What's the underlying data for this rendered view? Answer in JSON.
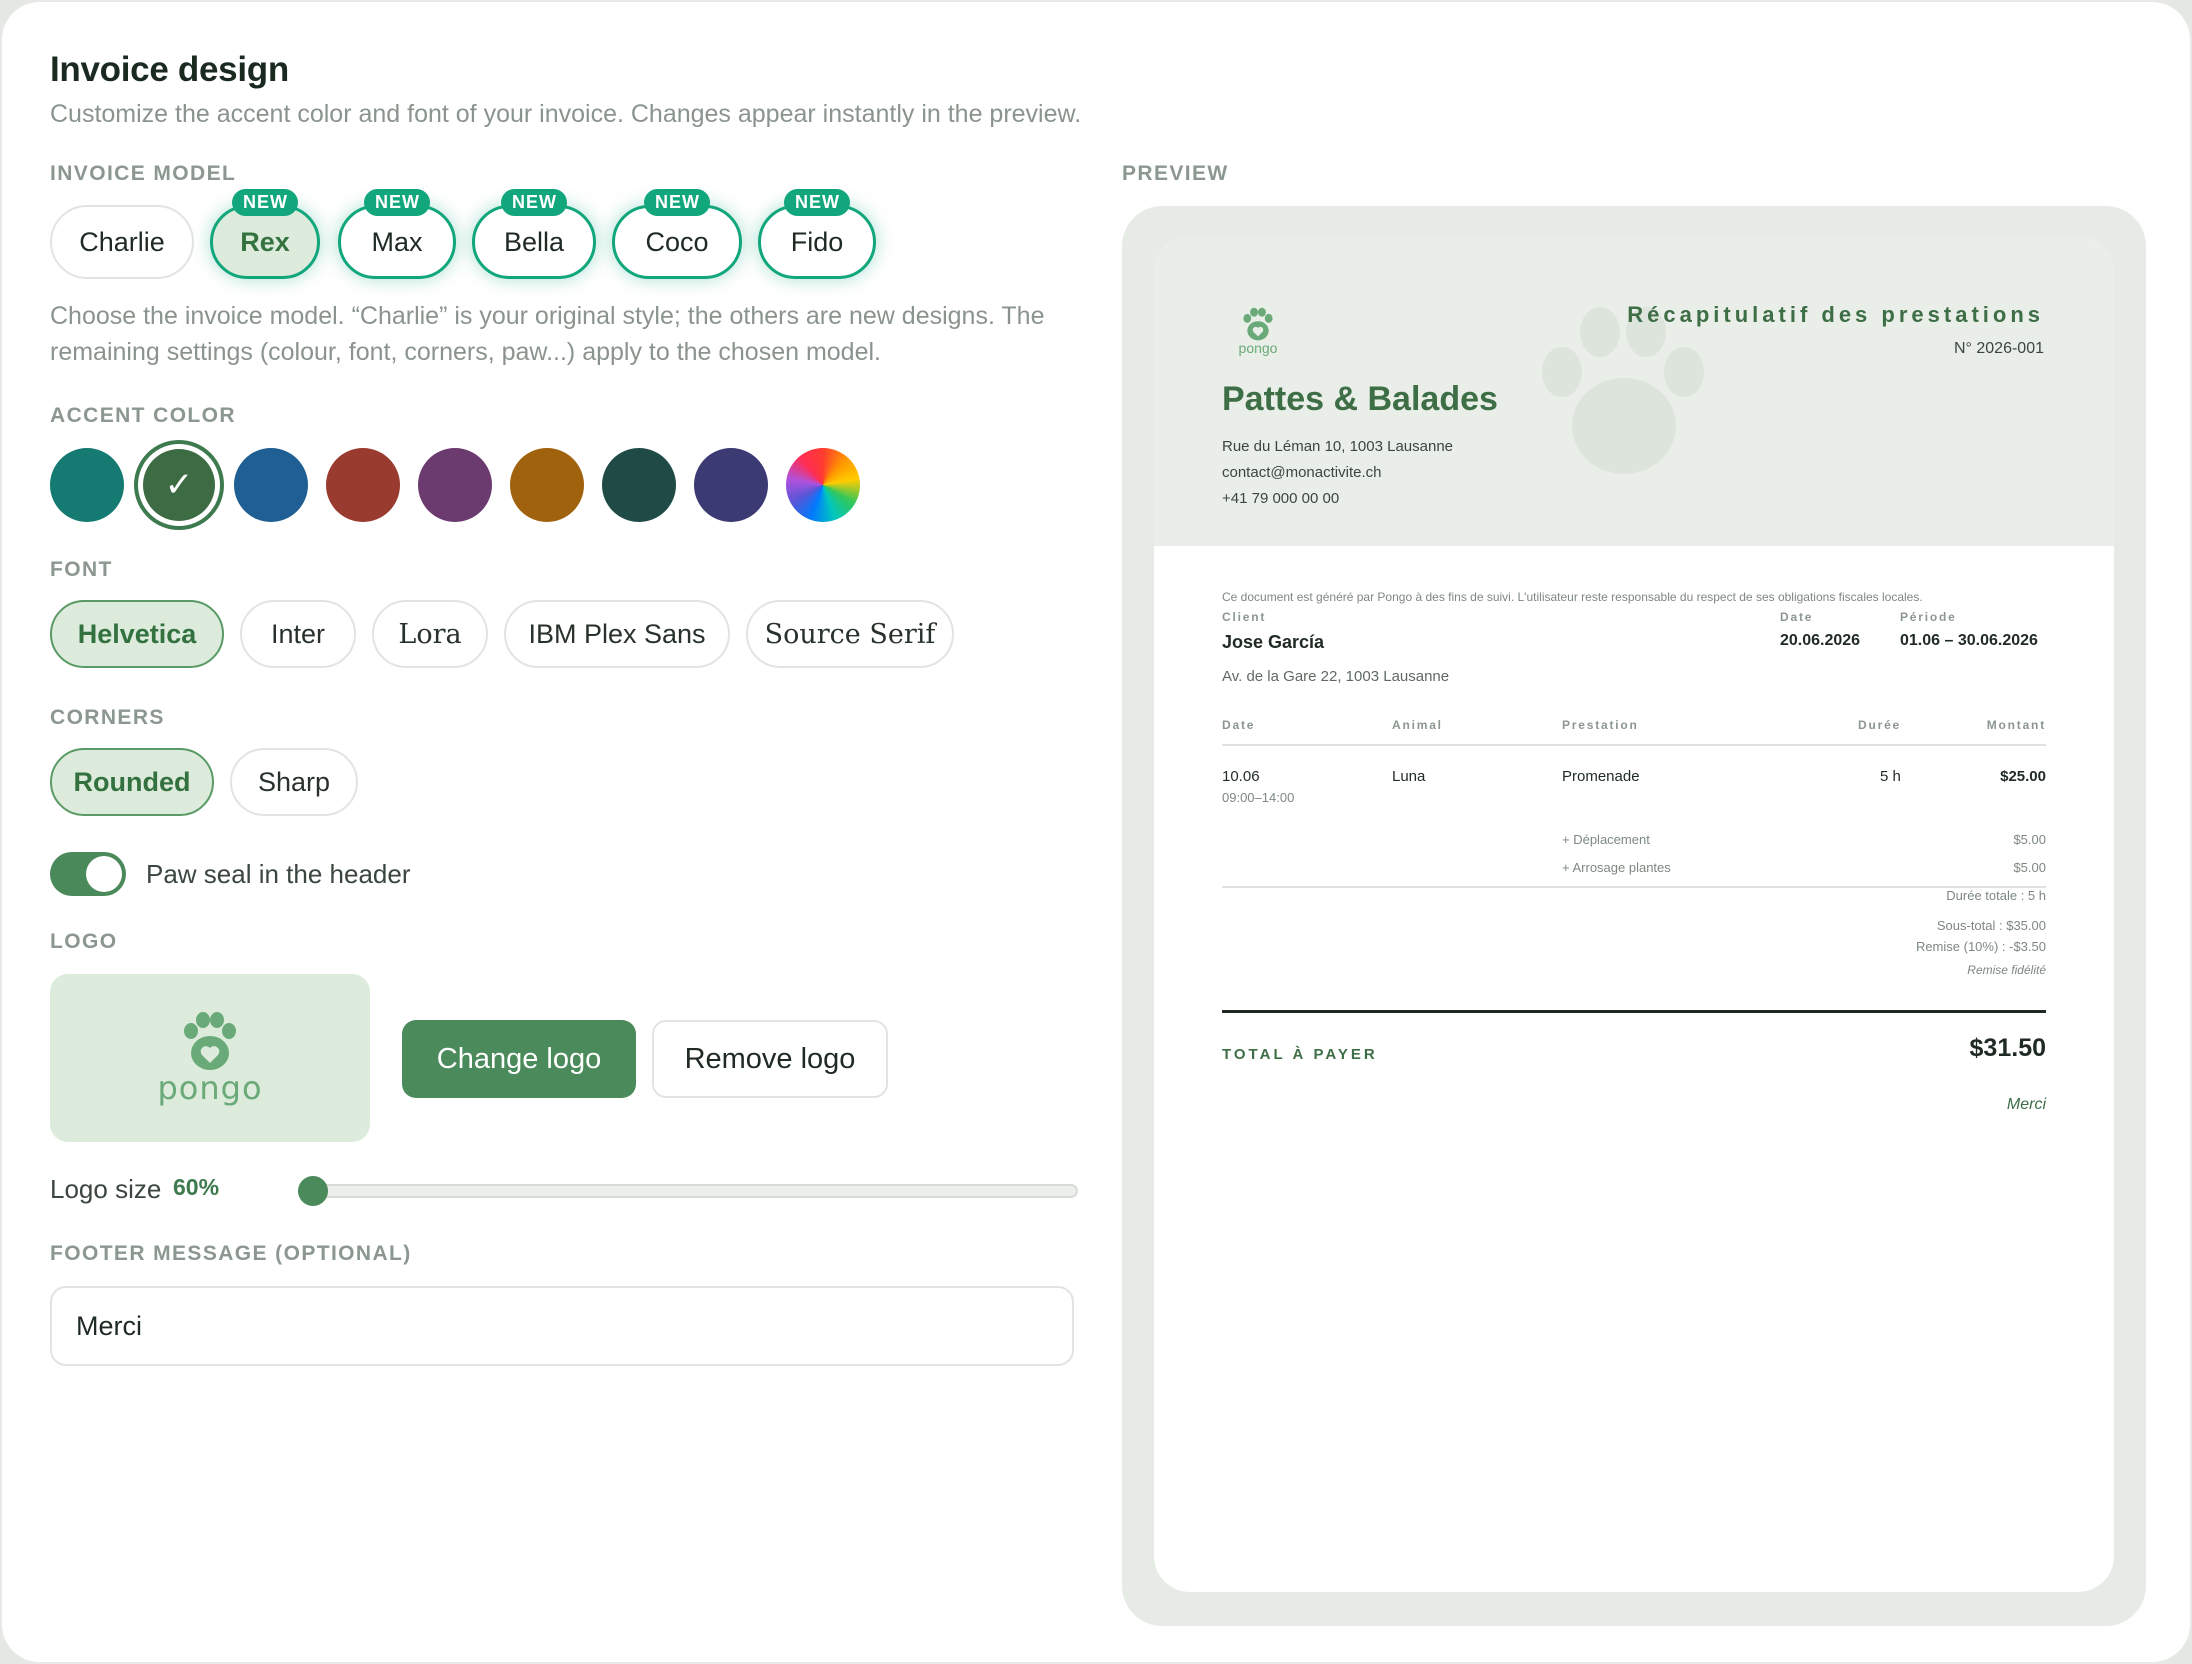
{
  "header": {
    "title": "Invoice design",
    "subtitle": "Customize the accent color and font of your invoice. Changes appear instantly in the preview."
  },
  "invoice_model": {
    "label": "INVOICE MODEL",
    "new_badge": "NEW",
    "models": [
      {
        "name": "Charlie",
        "is_new": false,
        "selected": false
      },
      {
        "name": "Rex",
        "is_new": true,
        "selected": true
      },
      {
        "name": "Max",
        "is_new": true,
        "selected": false
      },
      {
        "name": "Bella",
        "is_new": true,
        "selected": false
      },
      {
        "name": "Coco",
        "is_new": true,
        "selected": false
      },
      {
        "name": "Fido",
        "is_new": true,
        "selected": false
      }
    ],
    "help": "Choose the invoice model. “Charlie” is your original style; the others are new designs. The remaining settings (colour, font, corners, paw...) apply to the chosen model."
  },
  "accent_color": {
    "label": "ACCENT COLOR",
    "swatches": [
      "#157a72",
      "#3c6b44",
      "#1f5f93",
      "#9a3b30",
      "#6b3a6e",
      "#a0620c",
      "#1f4a45",
      "#3c3a73",
      "conic"
    ],
    "selected_index": 1
  },
  "font": {
    "label": "FONT",
    "options": [
      "Helvetica",
      "Inter",
      "Lora",
      "IBM Plex Sans",
      "Source Serif"
    ],
    "selected": "Helvetica"
  },
  "corners": {
    "label": "CORNERS",
    "options": [
      "Rounded",
      "Sharp"
    ],
    "selected": "Rounded"
  },
  "paw_seal": {
    "label": "Paw seal in the header",
    "enabled": true
  },
  "logo": {
    "label": "LOGO",
    "logo_text": "pongo",
    "change_button": "Change logo",
    "remove_button": "Remove logo",
    "size_label": "Logo size",
    "size_value": "60%",
    "size_fraction": 0
  },
  "footer_message": {
    "label": "FOOTER MESSAGE (OPTIONAL)",
    "value": "Merci"
  },
  "preview": {
    "label": "PREVIEW",
    "logo_text": "pongo",
    "doc_title": "Récapitulatif des prestations",
    "doc_number": "N° 2026-001",
    "business_name": "Pattes & Balades",
    "business_address": "Rue du Léman 10, 1003 Lausanne",
    "business_email": "contact@monactivite.ch",
    "business_phone": "+41 79 000 00 00",
    "disclaimer": "Ce document est généré par Pongo à des fins de suivi. L'utilisateur reste responsable du respect de ses obligations fiscales locales.",
    "client_label": "Client",
    "client_name": "Jose García",
    "client_address": "Av. de la Gare 22, 1003 Lausanne",
    "date_label": "Date",
    "date_value": "20.06.2026",
    "period_label": "Période",
    "period_value": "01.06 – 30.06.2026",
    "columns": [
      "Date",
      "Animal",
      "Prestation",
      "Durée",
      "Montant"
    ],
    "row": {
      "date": "10.06",
      "time": "09:00–14:00",
      "animal": "Luna",
      "service": "Promenade",
      "duration": "5 h",
      "amount": "$25.00"
    },
    "extras": [
      {
        "label": "+ Déplacement",
        "amount": "$5.00"
      },
      {
        "label": "+ Arrosage plantes",
        "amount": "$5.00"
      }
    ],
    "total_duration": "Durée totale : 5 h",
    "subtotal": "Sous-total : $35.00",
    "discount": "Remise (10%) : -$3.50",
    "discount_note": "Remise fidélité",
    "total_label": "TOTAL À PAYER",
    "total_value": "$31.50",
    "footer": "Merci"
  }
}
